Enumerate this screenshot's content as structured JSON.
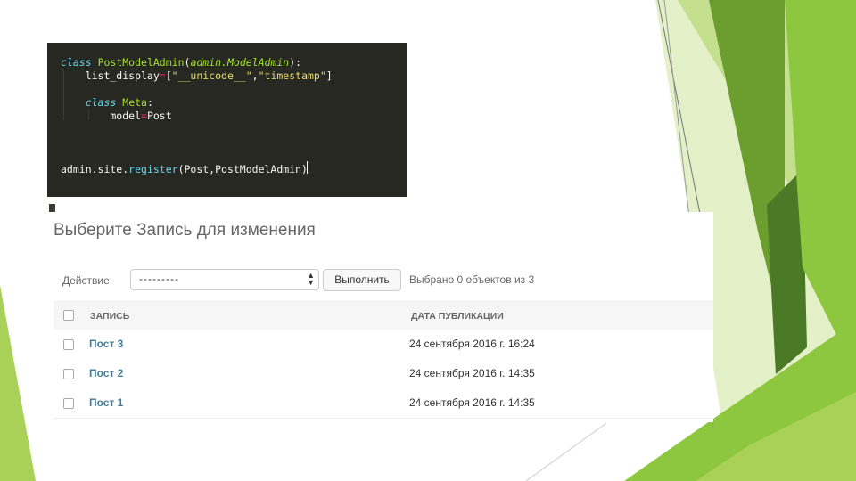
{
  "code": {
    "lines": [
      {
        "segments": [
          {
            "t": "class",
            "c": "#66d9ef",
            "i": true
          },
          {
            "t": " ",
            "c": "#f8f8f2"
          },
          {
            "t": "PostModelAdmin",
            "c": "#a6e22e"
          },
          {
            "t": "(",
            "c": "#f8f8f2"
          },
          {
            "t": "admin.ModelAdmin",
            "c": "#a6e22e",
            "i": true
          },
          {
            "t": "):",
            "c": "#f8f8f2"
          }
        ]
      },
      {
        "segments": [
          {
            "t": "    list_display",
            "c": "#f8f8f2"
          },
          {
            "t": "=",
            "c": "#f92672"
          },
          {
            "t": "[",
            "c": "#f8f8f2"
          },
          {
            "t": "\"__unicode__\"",
            "c": "#e6db74"
          },
          {
            "t": ",",
            "c": "#f8f8f2"
          },
          {
            "t": "\"timestamp\"",
            "c": "#e6db74"
          },
          {
            "t": "]",
            "c": "#f8f8f2"
          }
        ]
      },
      {
        "segments": []
      },
      {
        "segments": [
          {
            "t": "    ",
            "c": "#f8f8f2"
          },
          {
            "t": "class",
            "c": "#66d9ef",
            "i": true
          },
          {
            "t": " ",
            "c": "#f8f8f2"
          },
          {
            "t": "Meta",
            "c": "#a6e22e"
          },
          {
            "t": ":",
            "c": "#f8f8f2"
          }
        ]
      },
      {
        "segments": [
          {
            "t": "        model",
            "c": "#f8f8f2"
          },
          {
            "t": "=",
            "c": "#f92672"
          },
          {
            "t": "Post",
            "c": "#f8f8f2"
          }
        ]
      },
      {
        "segments": []
      },
      {
        "segments": []
      },
      {
        "segments": []
      },
      {
        "segments": [
          {
            "t": "admin.site.",
            "c": "#f8f8f2"
          },
          {
            "t": "register",
            "c": "#66d9ef"
          },
          {
            "t": "(Post,PostModelAdmin)",
            "c": "#f8f8f2"
          }
        ]
      }
    ]
  },
  "admin": {
    "title": "Выберите Запись для изменения",
    "action_label": "Действие:",
    "action_select": "---------",
    "go_button": "Выполнить",
    "selection_counter": "Выбрано 0 объектов из 3",
    "columns": [
      "ЗАПИСЬ",
      "ДАТА ПУБЛИКАЦИИ"
    ],
    "rows": [
      {
        "title": "Пост 3",
        "date": "24 сентября 2016 г. 16:24"
      },
      {
        "title": "Пост 2",
        "date": "24 сентября 2016 г. 14:35"
      },
      {
        "title": "Пост 1",
        "date": "24 сентября 2016 г. 14:35"
      }
    ],
    "link_color": "#447e9b"
  },
  "theme": {
    "accent_greens": [
      "#8dc63f",
      "#6b9e2e",
      "#4a7a25",
      "#c4df8e",
      "#a9d158",
      "#e3f0c8"
    ]
  }
}
